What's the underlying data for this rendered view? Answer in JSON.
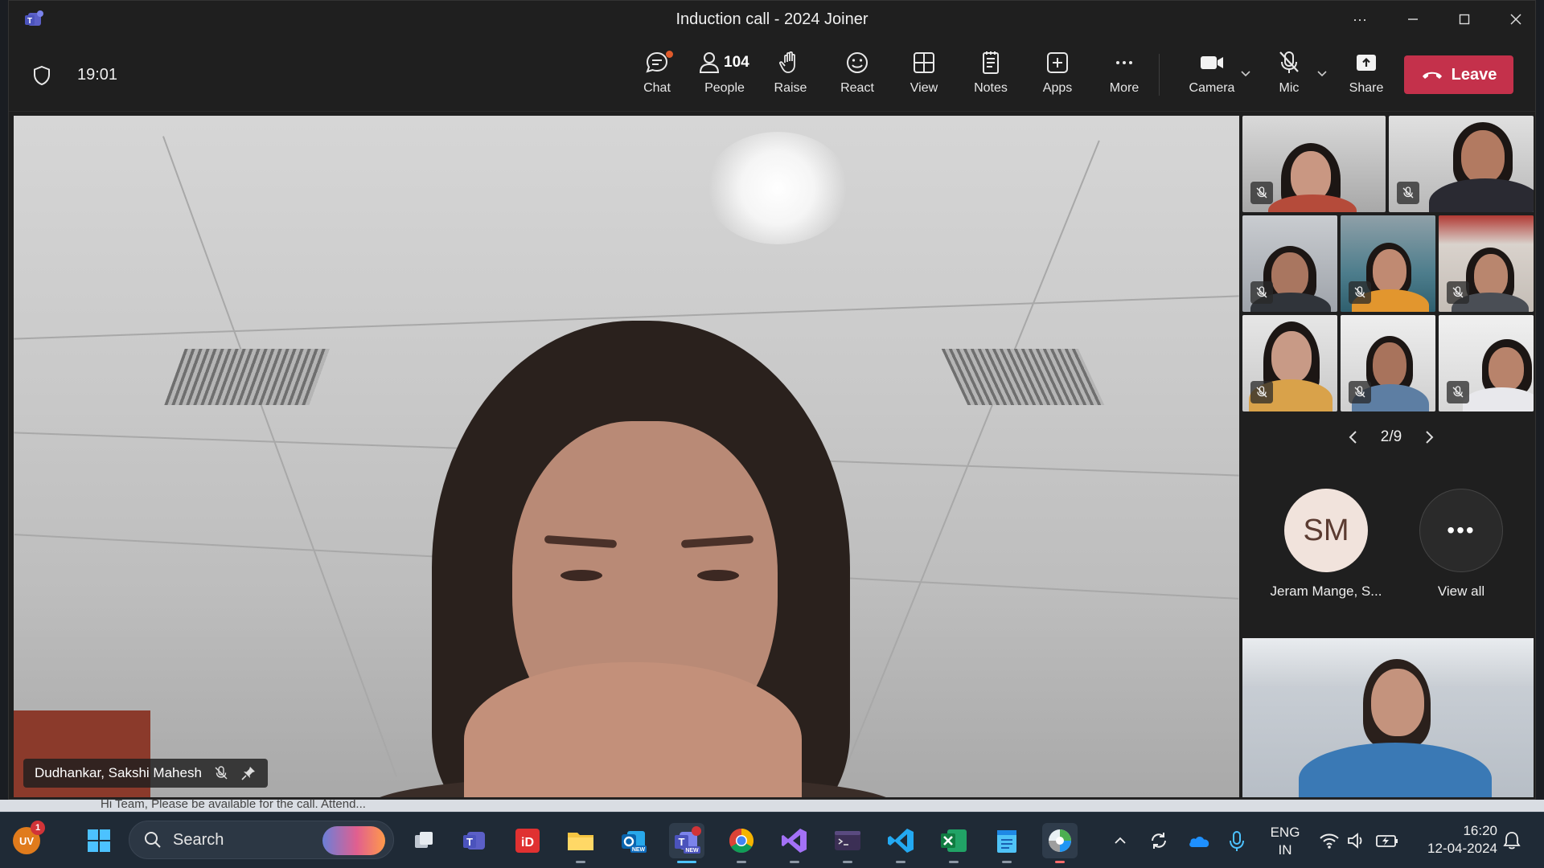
{
  "window": {
    "title": "Induction call - 2024 Joiner",
    "more": "···"
  },
  "meeting": {
    "timer": "19:01",
    "people_count": "104"
  },
  "toolbar": {
    "chat": "Chat",
    "people": "People",
    "raise": "Raise",
    "react": "React",
    "view": "View",
    "notes": "Notes",
    "apps": "Apps",
    "more": "More",
    "camera": "Camera",
    "mic": "Mic",
    "share": "Share",
    "leave": "Leave"
  },
  "main_video": {
    "participant_name": "Dudhankar, Sakshi Mahesh"
  },
  "gallery": {
    "page": "2/9",
    "overflow_participant": {
      "initials": "SM",
      "name": "Jeram Mange, S..."
    },
    "view_all": "View all",
    "view_all_glyph": "•••"
  },
  "desktop": {
    "notification_snippet": "Hi Team, Please be available for the call. Attend..."
  },
  "taskbar": {
    "search_placeholder": "Search",
    "user_initials": "UV",
    "user_badge_count": "1",
    "language_line1": "ENG",
    "language_line2": "IN",
    "time": "16:20",
    "date": "12-04-2024"
  },
  "colors": {
    "leave_button": "#c4314b",
    "toolbar_bg": "#1f1f1f",
    "taskbar_bg": "#1f2a36",
    "avatar_bg": "#f1e3dc"
  }
}
